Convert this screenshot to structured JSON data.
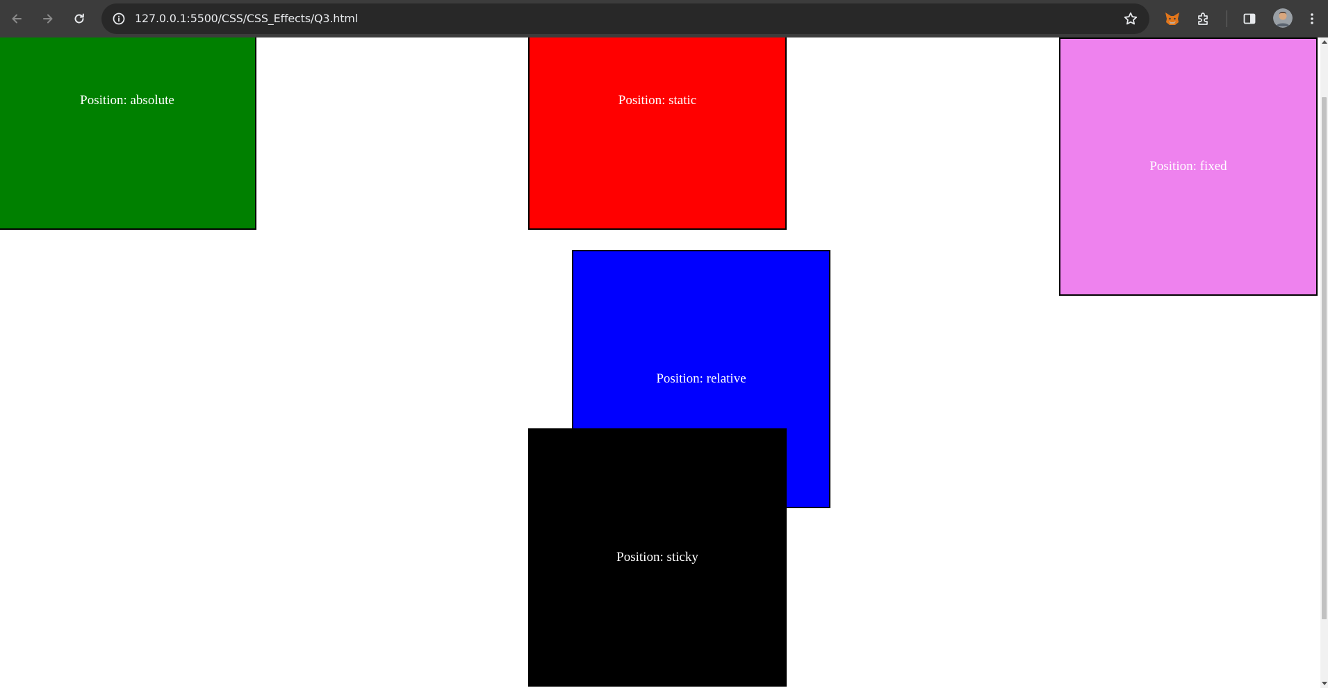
{
  "browser": {
    "url_host": "127.0.0.1",
    "url_path": ":5500/CSS/CSS_Effects/Q3.html",
    "icons": {
      "back": "arrow-left-icon",
      "forward": "arrow-right-icon",
      "reload": "reload-icon",
      "site_info": "info-icon",
      "bookmark": "star-icon",
      "extension_fox": "fox-extension-icon",
      "extensions": "puzzle-icon",
      "side_panel": "side-panel-icon",
      "profile": "avatar",
      "menu": "kebab-menu-icon"
    }
  },
  "page": {
    "boxes": {
      "absolute": {
        "label": "Position: absolute",
        "color": "#008000"
      },
      "static": {
        "label": "Position: static",
        "color": "#ff0000"
      },
      "fixed": {
        "label": "Position: fixed",
        "color": "#ee82ee"
      },
      "relative": {
        "label": "Position: relative",
        "color": "#0000ff"
      },
      "sticky": {
        "label": "Position: sticky",
        "color": "#000000"
      }
    }
  }
}
